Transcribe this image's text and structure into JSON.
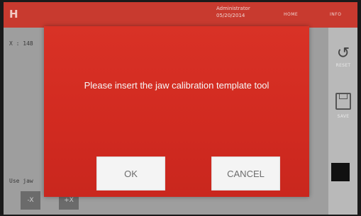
{
  "topbar": {
    "logo": "H",
    "user_name": "Administrator",
    "user_date": "05/20/2014",
    "home_label": "HOME",
    "info_label": "INFO"
  },
  "background": {
    "coord_text": "X : 148",
    "hint_text": "Use jaw",
    "jog_minus": "-X",
    "jog_plus": "+X"
  },
  "right_panel": {
    "reset_label": "RESET",
    "save_label": "SAVE"
  },
  "dialog": {
    "message": "Please insert the jaw calibration template tool",
    "ok_label": "OK",
    "cancel_label": "CANCEL"
  },
  "colors": {
    "dialog_red": "#d62d22",
    "topbar_red": "#c83a2f",
    "button_bg": "#f4f4f4"
  }
}
